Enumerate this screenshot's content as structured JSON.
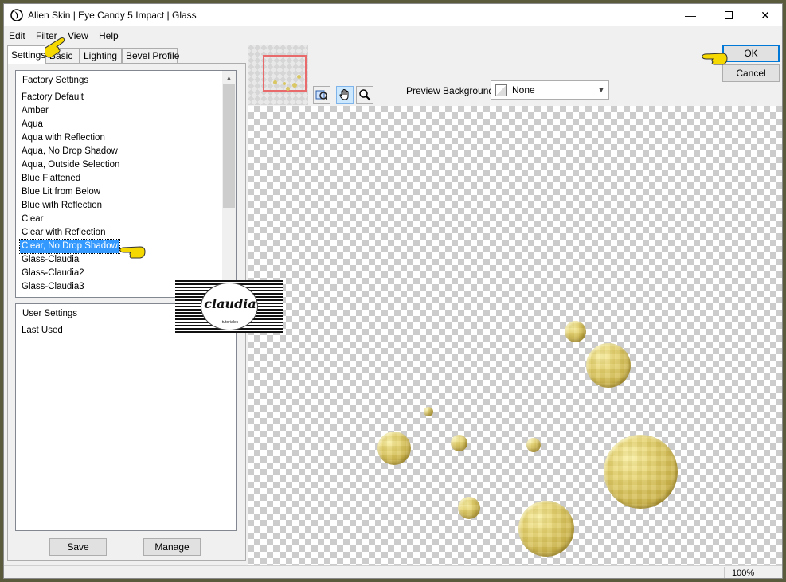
{
  "window": {
    "title": "Alien Skin | Eye Candy 5 Impact | Glass"
  },
  "menu": [
    "Edit",
    "Filter",
    "View",
    "Help"
  ],
  "tabs": [
    "Settings",
    "Basic",
    "Lighting",
    "Bevel Profile"
  ],
  "factory_settings": {
    "header": "Factory Settings",
    "items": [
      "Factory Default",
      "Amber",
      "Aqua",
      "Aqua with Reflection",
      "Aqua, No Drop Shadow",
      "Aqua, Outside Selection",
      "Blue Flattened",
      "Blue Lit from Below",
      "Blue with Reflection",
      "Clear",
      "Clear with Reflection",
      "Clear, No Drop Shadow",
      "Glass-Claudia",
      "Glass-Claudia2",
      "Glass-Claudia3"
    ],
    "selected": "Clear, No Drop Shadow"
  },
  "user_settings": {
    "header": "User Settings",
    "items": [
      "Last Used"
    ]
  },
  "buttons": {
    "save": "Save",
    "manage": "Manage",
    "ok": "OK",
    "cancel": "Cancel"
  },
  "preview_background": {
    "label": "Preview Background:",
    "value": "None"
  },
  "status": {
    "zoom": "100%"
  },
  "watermark": {
    "text": "claudia",
    "subtext": "tutoriales"
  },
  "colors": {
    "selection": "#3399ff",
    "bubble_gold": "#e8d675",
    "pointer_yellow": "#f5d800"
  },
  "icons": [
    "app-icon",
    "minimize-icon",
    "maximize-icon",
    "close-icon",
    "navigator-icon",
    "hand-tool-icon",
    "zoom-tool-icon",
    "pointing-hand-icon"
  ]
}
